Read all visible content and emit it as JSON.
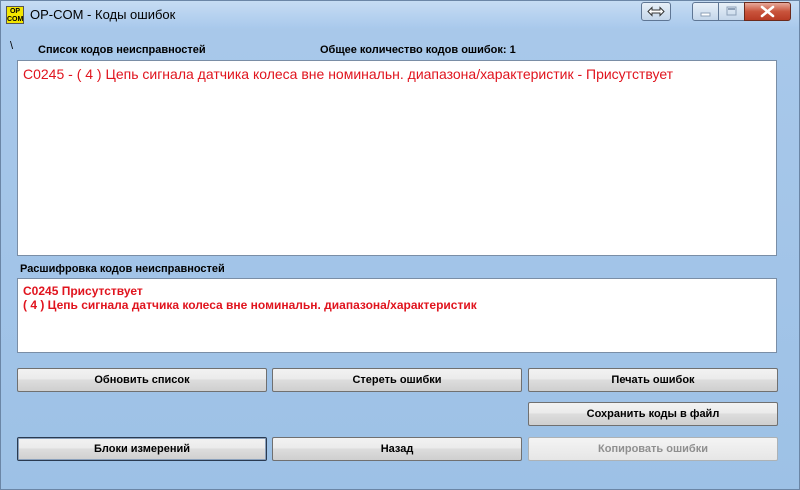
{
  "window": {
    "icon_text_top": "OP",
    "icon_text_bottom": "COM",
    "title": "OP-COM - Коды ошибок"
  },
  "header": {
    "marker": "\\",
    "list_label": "Список кодов неисправностей",
    "total_label": "Общее количество кодов ошибок:",
    "total_count": "1"
  },
  "codes_list": {
    "items": [
      "C0245 - ( 4 )  Цепь сигнала датчика колеса вне номинальн. диапазона/характеристик - Присутствует"
    ]
  },
  "decode": {
    "label": "Расшифровка кодов неисправностей",
    "line1": "C0245  Присутствует",
    "line2": "( 4 )  Цепь сигнала датчика колеса вне номинальн. диапазона/характеристик"
  },
  "buttons": {
    "refresh": "Обновить список",
    "clear": "Стереть ошибки",
    "print": "Печать ошибок",
    "save": "Сохранить коды в файл",
    "blocks": "Блоки измерений",
    "back": "Назад",
    "copy": "Копировать ошибки"
  },
  "colors": {
    "error_text": "#e0141e",
    "window_bg": "#9fc3e6"
  },
  "icons": {
    "restore": "double-arrow-icon",
    "minimize": "minimize-icon",
    "maximize": "maximize-icon",
    "close": "close-icon"
  }
}
